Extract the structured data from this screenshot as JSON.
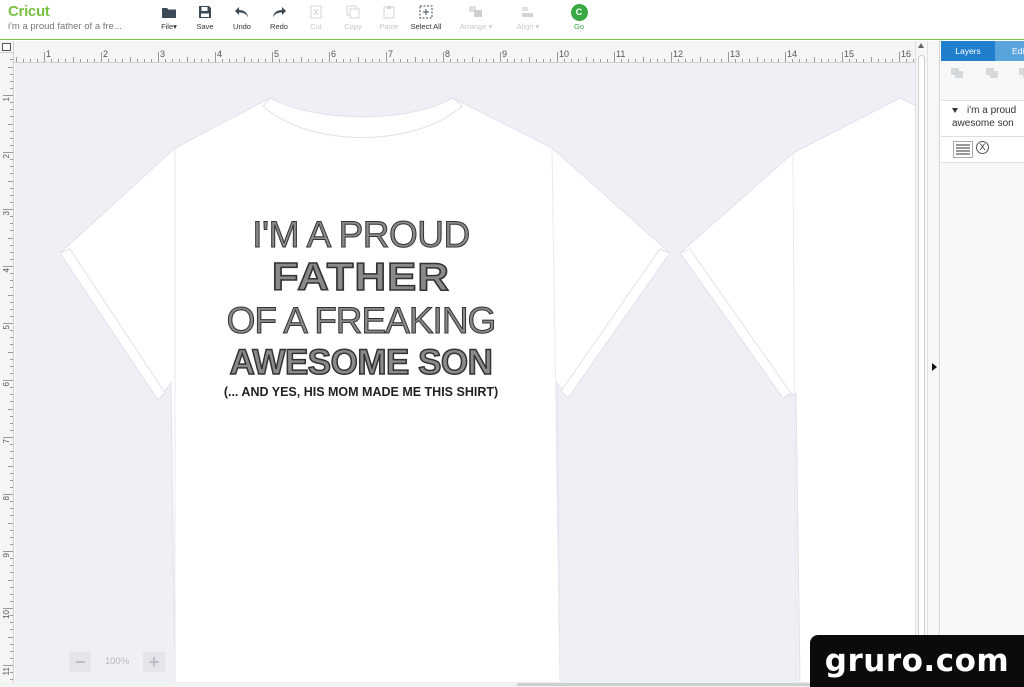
{
  "app": {
    "brand": "Cricut",
    "document_title": "i'm a proud father of a fre..."
  },
  "toolbar": {
    "buttons": [
      {
        "id": "file",
        "label": "File",
        "icon": "folder-icon",
        "enabled": true,
        "has_menu": true
      },
      {
        "id": "save",
        "label": "Save",
        "icon": "save-icon",
        "enabled": true
      },
      {
        "id": "undo",
        "label": "Undo",
        "icon": "undo-icon",
        "enabled": true
      },
      {
        "id": "redo",
        "label": "Redo",
        "icon": "redo-icon",
        "enabled": true
      },
      {
        "id": "cut",
        "label": "Cut",
        "icon": "cut-icon",
        "enabled": false
      },
      {
        "id": "copy",
        "label": "Copy",
        "icon": "copy-icon",
        "enabled": false
      },
      {
        "id": "paste",
        "label": "Paste",
        "icon": "paste-icon",
        "enabled": false
      },
      {
        "id": "select_all",
        "label": "Select All",
        "icon": "select-all-icon",
        "enabled": true
      },
      {
        "id": "arrange",
        "label": "Arrange",
        "icon": "arrange-icon",
        "enabled": false,
        "has_menu": true
      },
      {
        "id": "align",
        "label": "Align",
        "icon": "align-icon",
        "enabled": false,
        "has_menu": true
      },
      {
        "id": "go",
        "label": "Go",
        "icon": "go-icon",
        "enabled": true
      }
    ],
    "go_glyph": "C",
    "file_caret": "▾"
  },
  "ruler": {
    "top_numbers": [
      "1",
      "2",
      "3",
      "4",
      "5",
      "6",
      "7",
      "8",
      "9",
      "10",
      "11",
      "12",
      "13",
      "14",
      "15",
      "16"
    ],
    "left_numbers": [
      "1",
      "2",
      "3",
      "4",
      "5",
      "6",
      "7",
      "8",
      "9",
      "10",
      "11"
    ]
  },
  "design": {
    "line1": "I'M A PROUD",
    "line2": "FATHER",
    "line3": "OF A FREAKING",
    "line4": "AWESOME SON",
    "line5": "(... AND YES, HIS MOM MADE ME THIS SHIRT)"
  },
  "zoom": {
    "minus": "−",
    "value": "100%",
    "plus": "+"
  },
  "panel": {
    "tabs": {
      "layers": "Layers",
      "edit": "Edit"
    },
    "layer_group": {
      "line1": "i'm a proud",
      "line2": "awesome son"
    },
    "layer_op_glyph": "X"
  },
  "watermark": "gruro.com",
  "colors": {
    "brand_green": "#7ac143",
    "go_green": "#39a845",
    "tab_active": "#1f7ecd",
    "canvas_bg": "#eef0f5",
    "design_fill": "#8a8a8a"
  }
}
